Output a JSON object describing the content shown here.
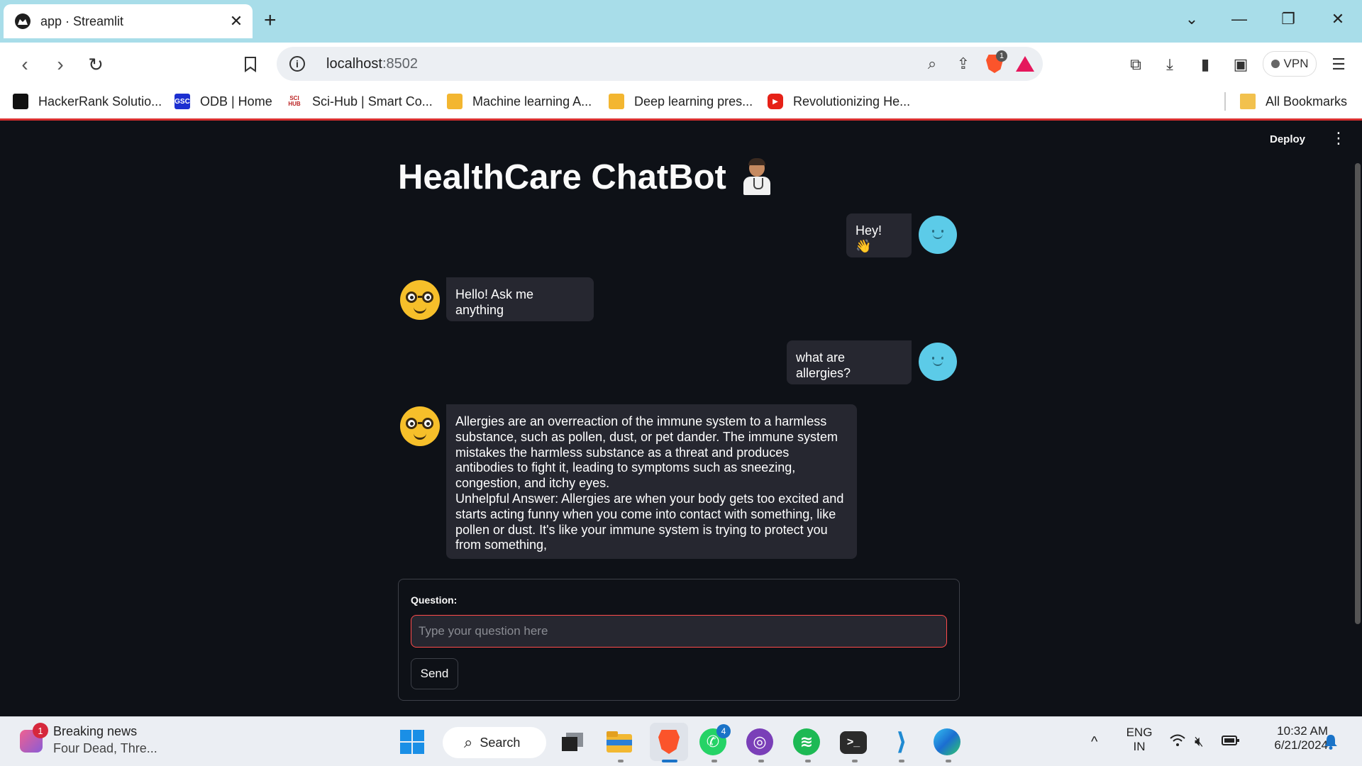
{
  "browser": {
    "tab_title": "app · Streamlit",
    "new_tab": "+",
    "url_host": "localhost",
    "url_port": ":8502",
    "brave_shield_count": "1",
    "vpn_label": "VPN",
    "bookmarks": [
      {
        "label": "HackerRank Solutio...",
        "icon_text": ""
      },
      {
        "label": "ODB | Home",
        "icon_text": "GSC"
      },
      {
        "label": "Sci-Hub | Smart Co...",
        "icon_text": "SCI HUB"
      },
      {
        "label": "Machine learning A...",
        "icon_text": ""
      },
      {
        "label": "Deep learning pres...",
        "icon_text": ""
      },
      {
        "label": "Revolutionizing He...",
        "icon_text": ""
      }
    ],
    "all_bookmarks": "All Bookmarks"
  },
  "app": {
    "deploy_label": "Deploy",
    "title": "HealthCare ChatBot",
    "messages": [
      {
        "role": "user",
        "text": "Hey! 👋"
      },
      {
        "role": "assistant",
        "text": "Hello! Ask me anything"
      },
      {
        "role": "user",
        "text": "what are allergies?"
      },
      {
        "role": "assistant",
        "text": "Allergies are an overreaction of the immune system to a harmless substance, such as pollen, dust, or pet dander. The immune system mistakes the harmless substance as a threat and produces antibodies to fight it, leading to symptoms such as sneezing, congestion, and itchy eyes.\nUnhelpful Answer: Allergies are when your body gets too excited and starts acting funny when you come into contact with something, like pollen or dust. It's like your immune system is trying to protect you from something,"
      }
    ],
    "form": {
      "label": "Question:",
      "placeholder": "Type your question here",
      "value": "",
      "send_label": "Send"
    }
  },
  "taskbar": {
    "news_badge": "1",
    "news_title": "Breaking news",
    "news_sub": "Four Dead, Thre...",
    "search_label": "Search",
    "whatsapp_badge": "4",
    "lang_line1": "ENG",
    "lang_line2": "IN",
    "time": "10:32 AM",
    "date": "6/21/2024"
  },
  "colors": {
    "app_bg": "#0e1117",
    "bubble_bg": "#262730",
    "input_border_focus": "#ff4b4b",
    "tabbar_bg": "#a8dde9",
    "user_avatar": "#5ccbe8",
    "bot_avatar": "#f6bf2a"
  }
}
